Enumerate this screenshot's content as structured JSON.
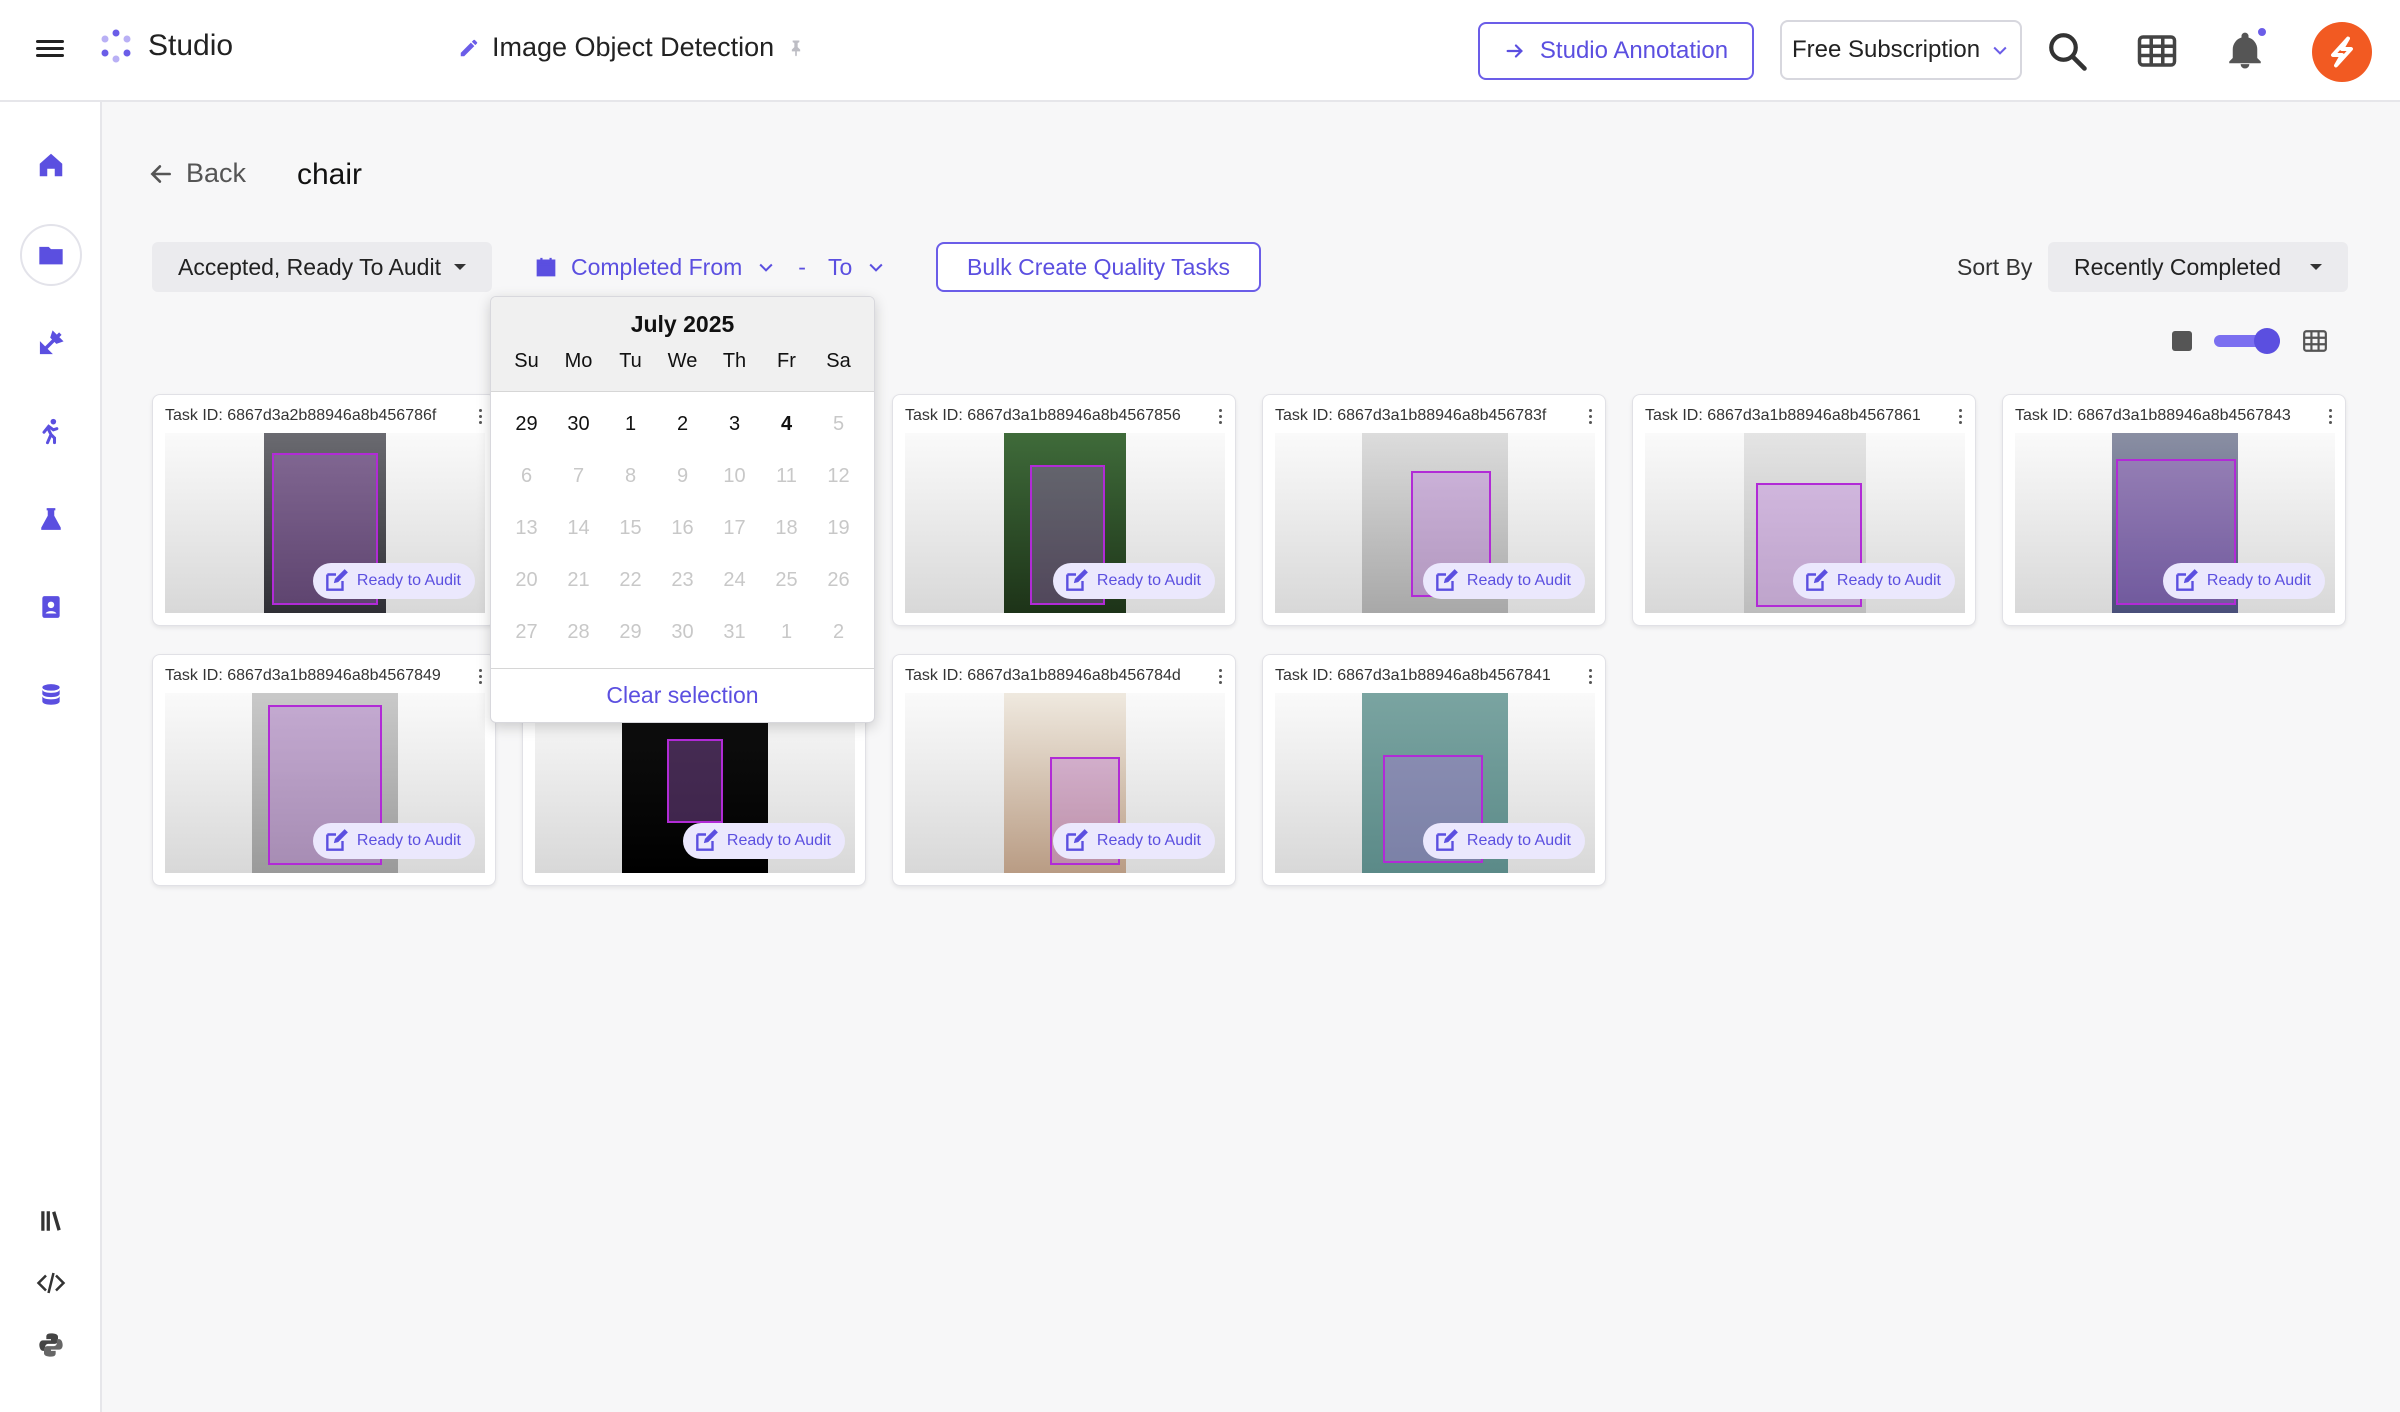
{
  "app": {
    "brand": "Studio",
    "project_title": "Image Object Detection"
  },
  "topbar": {
    "annotation_button": "Studio Annotation",
    "subscription": "Free Subscription",
    "icons": [
      "menu-icon",
      "search-icon",
      "apps-grid-icon",
      "bell-icon"
    ]
  },
  "sidebar": {
    "items": [
      "home-icon",
      "folder-icon",
      "tools-icon",
      "activity-icon",
      "lab-icon",
      "contacts-icon",
      "database-icon",
      "library-icon",
      "code-icon",
      "python-icon"
    ]
  },
  "header": {
    "back_label": "Back",
    "title": "chair"
  },
  "filters": {
    "status": "Accepted, Ready To Audit",
    "completed_from": "Completed From",
    "dash": "-",
    "to": "To",
    "bulk_button": "Bulk Create Quality Tasks",
    "sort_label": "Sort By",
    "sort_value": "Recently Completed"
  },
  "view": {
    "grid_view_on": true
  },
  "datepicker": {
    "month": "July 2025",
    "weekdays": [
      "Su",
      "Mo",
      "Tu",
      "We",
      "Th",
      "Fr",
      "Sa"
    ],
    "weeks": [
      [
        "29",
        "30",
        "1",
        "2",
        "3",
        "4",
        "5"
      ],
      [
        "6",
        "7",
        "8",
        "9",
        "10",
        "11",
        "12"
      ],
      [
        "13",
        "14",
        "15",
        "16",
        "17",
        "18",
        "19"
      ],
      [
        "20",
        "21",
        "22",
        "23",
        "24",
        "25",
        "26"
      ],
      [
        "27",
        "28",
        "29",
        "30",
        "31",
        "1",
        "2"
      ]
    ],
    "today": "4",
    "clear_label": "Clear selection"
  },
  "tasks": [
    {
      "id_label": "Task ID: 6867d3a2b88946a8b456786f",
      "status": "Ready to Audit"
    },
    {
      "id_label": "Task ID: 6867d3a1b88946a8b4567856",
      "status": "Ready to Audit"
    },
    {
      "id_label": "Task ID: 6867d3a1b88946a8b456783f",
      "status": "Ready to Audit"
    },
    {
      "id_label": "Task ID: 6867d3a1b88946a8b4567861",
      "status": "Ready to Audit"
    },
    {
      "id_label": "Task ID: 6867d3a1b88946a8b4567843",
      "status": "Ready to Audit"
    },
    {
      "id_label": "Task ID: 6867d3a1b88946a8b4567849",
      "status": "Ready to Audit"
    },
    {
      "id_label": "",
      "status": "Ready to Audit"
    },
    {
      "id_label": "Task ID: 6867d3a1b88946a8b456784d",
      "status": "Ready to Audit"
    },
    {
      "id_label": "Task ID: 6867d3a1b88946a8b4567841",
      "status": "Ready to Audit"
    }
  ],
  "colors": {
    "accent": "#5b4fe0",
    "avatar": "#f25a22",
    "bbox": "#b12bd6"
  }
}
